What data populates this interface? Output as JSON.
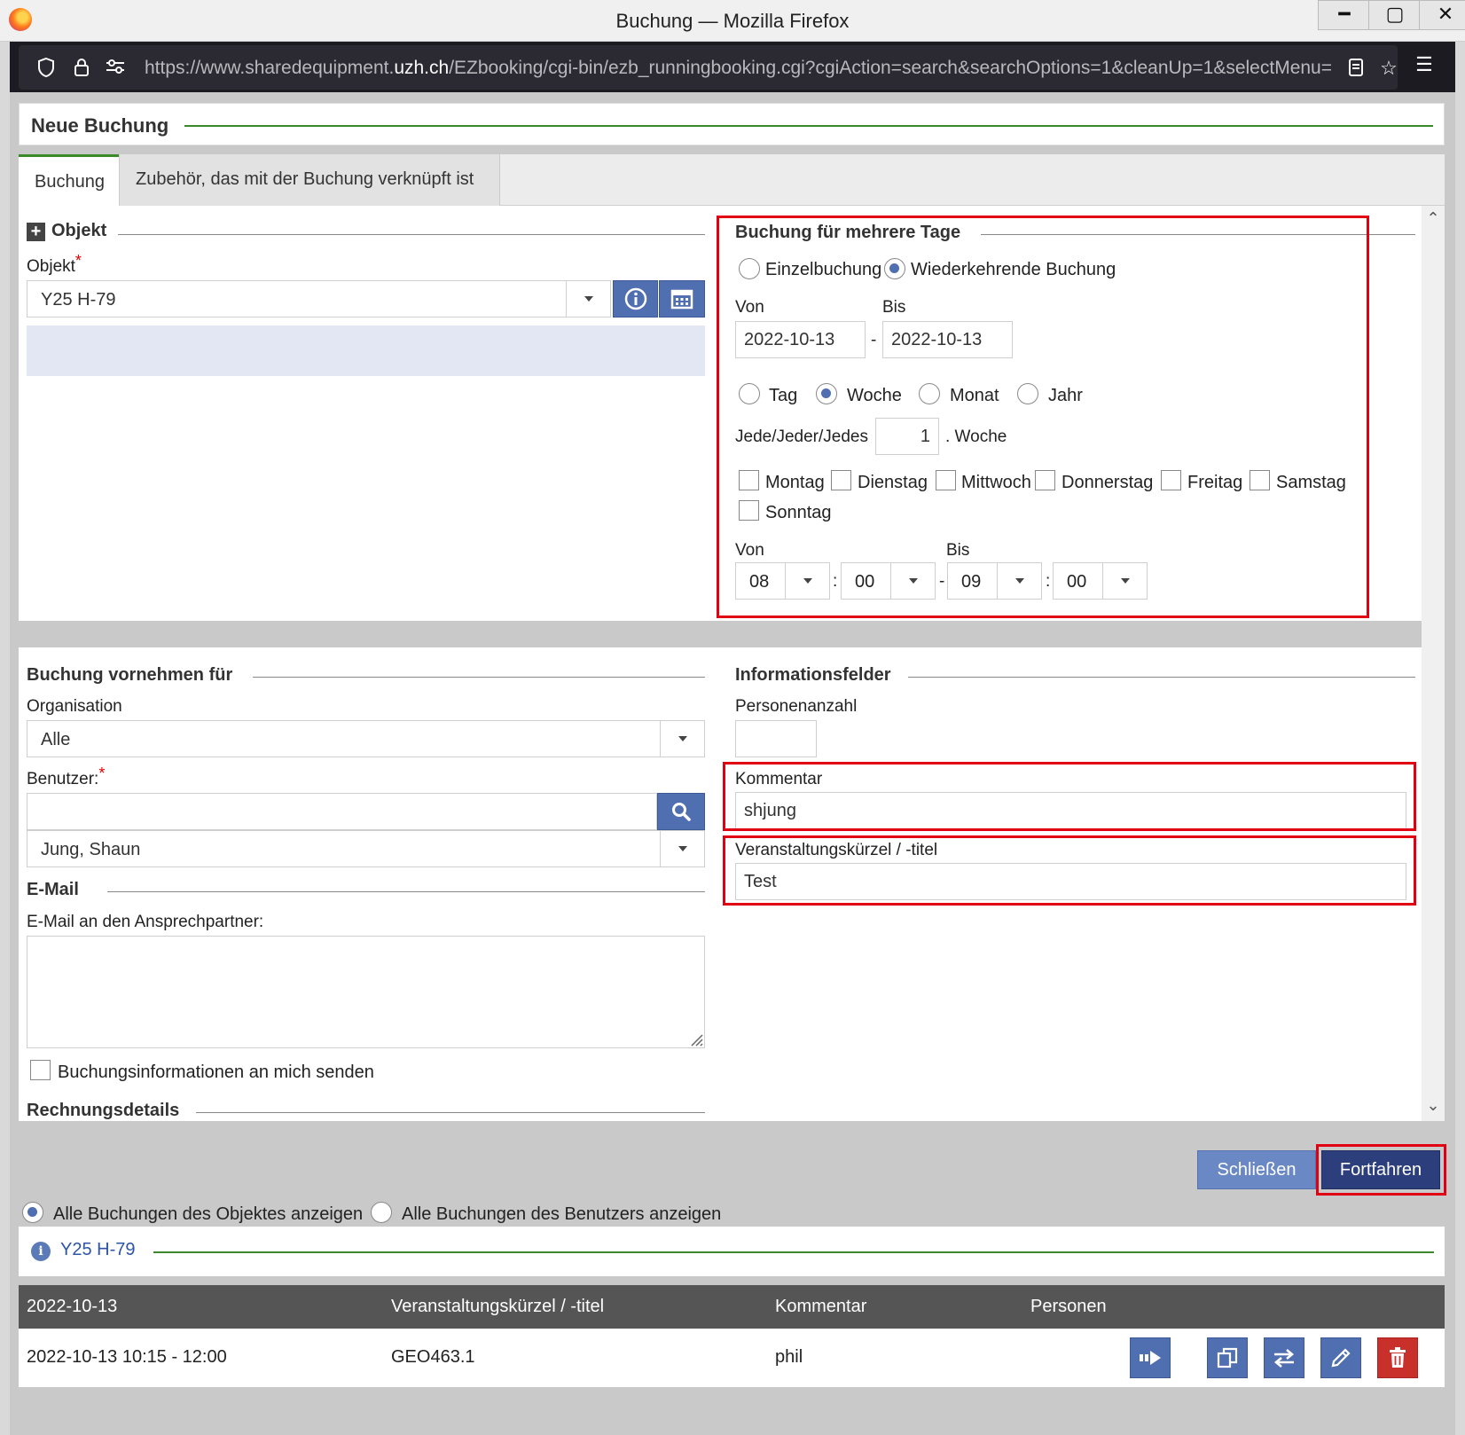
{
  "window": {
    "title": "Buchung — Mozilla Firefox",
    "url_prefix": "https://www.sharedequipment.",
    "url_domain": "uzh.ch",
    "url_suffix": "/EZbooking/cgi-bin/ezb_runningbooking.cgi?cgiAction=search&searchOptions=1&cleanUp=1&selectMenu="
  },
  "header": {
    "title": "Neue Buchung"
  },
  "tabs": [
    {
      "label": "Buchung"
    },
    {
      "label": "Zubehör, das mit der Buchung verknüpft ist"
    }
  ],
  "objekt": {
    "legend": "Objekt",
    "label": "Objekt",
    "required_mark": "*",
    "value": "Y25 H-79"
  },
  "multi": {
    "legend": "Buchung für mehrere Tage",
    "type_single": "Einzelbuchung",
    "type_recurring": "Wiederkehrende Buchung",
    "selected_type": "recurring",
    "von_label": "Von",
    "bis_label": "Bis",
    "date_from": "2022-10-13",
    "date_to": "2022-10-13",
    "dash": "-",
    "periods": [
      "Tag",
      "Woche",
      "Monat",
      "Jahr"
    ],
    "selected_period": "Woche",
    "every_label": "Jede/Jeder/Jedes",
    "every_value": "1",
    "every_unit": ". Woche",
    "days": [
      "Montag",
      "Dienstag",
      "Mittwoch",
      "Donnerstag",
      "Freitag",
      "Samstag",
      "Sonntag"
    ],
    "time_von_label": "Von",
    "time_bis_label": "Bis",
    "time_from_h": "08",
    "time_from_m": "00",
    "time_to_h": "09",
    "time_to_m": "00",
    "colon": ":"
  },
  "fuer": {
    "legend": "Buchung vornehmen für",
    "org_label": "Organisation",
    "org_value": "Alle",
    "user_label": "Benutzer:",
    "required_mark": "*",
    "user_search": "",
    "user_value": "Jung, Shaun"
  },
  "email": {
    "legend": "E-Mail",
    "label": "E-Mail an den Ansprechpartner:",
    "value": "",
    "send_me": "Buchungsinformationen an mich senden"
  },
  "rechnung": {
    "legend": "Rechnungsdetails"
  },
  "info": {
    "legend": "Informationsfelder",
    "persons_label": "Personenanzahl",
    "persons_value": "",
    "comment_label": "Kommentar",
    "comment_value": "shjung",
    "title_label": "Veranstaltungskürzel / -titel",
    "title_value": "Test"
  },
  "buttons": {
    "close": "Schließen",
    "next": "Fortfahren"
  },
  "show": {
    "object_bookings": "Alle Buchungen des Objektes anzeigen",
    "user_bookings": "Alle Buchungen des Benutzers anzeigen",
    "selected": "object"
  },
  "object_bar": {
    "title": "Y25 H-79",
    "icon": "info-icon"
  },
  "table": {
    "headers": [
      "2022-10-13",
      "Veranstaltungskürzel / -titel",
      "Kommentar",
      "Personen"
    ],
    "rows": [
      {
        "time": "2022-10-13 10:15 - 12:00",
        "title": "GEO463.1",
        "comment": "phil",
        "persons": ""
      }
    ]
  },
  "colors": {
    "accent": "#4f6fb0",
    "green_line": "#3a8a2a",
    "highlight": "#e00012",
    "primary_dark": "#2c3f7c",
    "danger": "#c9302c"
  }
}
